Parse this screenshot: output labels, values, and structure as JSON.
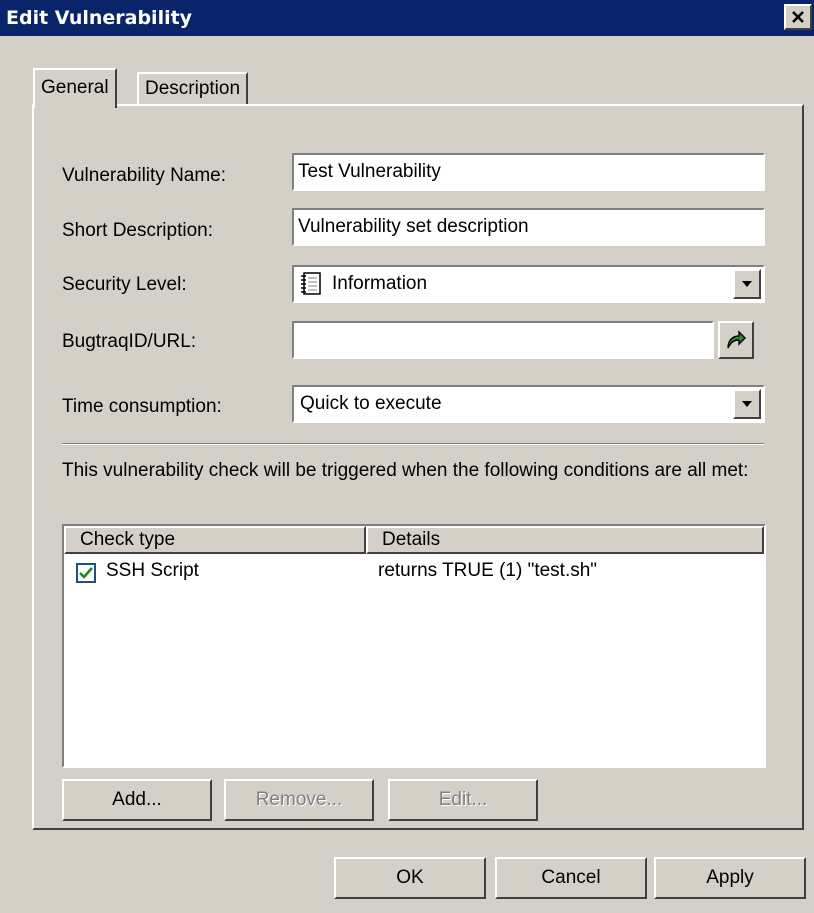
{
  "window": {
    "title": "Edit Vulnerability"
  },
  "tabs": [
    {
      "label": "General",
      "active": true
    },
    {
      "label": "Description",
      "active": false
    }
  ],
  "form": {
    "vuln_name": {
      "label": "Vulnerability Name:",
      "value": "Test Vulnerability"
    },
    "short_desc": {
      "label": "Short Description:",
      "value": "Vulnerability set description"
    },
    "security_level": {
      "label": "Security Level:",
      "value": "Information",
      "icon": "notepad-icon"
    },
    "bugtraq": {
      "label": "BugtraqID/URL:",
      "value": ""
    },
    "time": {
      "label": "Time consumption:",
      "value": "Quick to execute"
    }
  },
  "conditions": {
    "text": "This vulnerability check will be triggered when the following conditions are all met:",
    "columns": [
      "Check type",
      "Details"
    ],
    "rows": [
      {
        "checked": true,
        "type": "SSH Script",
        "details": "returns TRUE (1) \"test.sh\""
      }
    ]
  },
  "list_buttons": {
    "add": "Add...",
    "remove": "Remove...",
    "edit": "Edit..."
  },
  "dialog_buttons": {
    "ok": "OK",
    "cancel": "Cancel",
    "apply": "Apply"
  },
  "colors": {
    "titlebar": "#0a246a",
    "face": "#d4d0c8",
    "go_arrow": "#2e8b2e",
    "check": "#1c8a1c"
  }
}
